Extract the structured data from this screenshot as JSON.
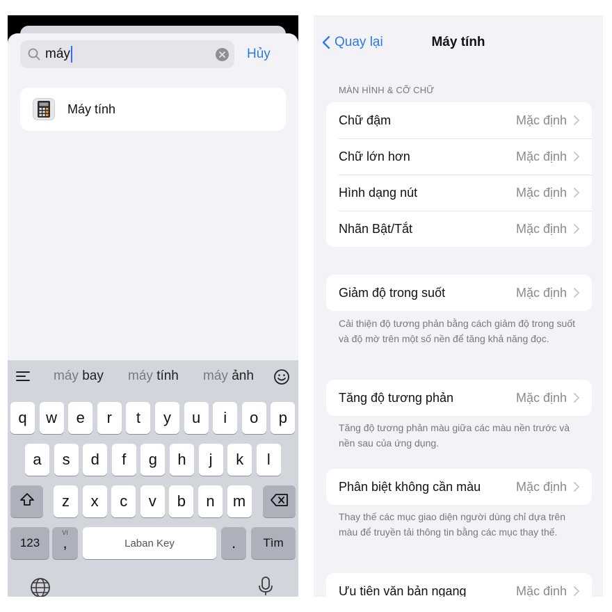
{
  "search": {
    "query": "máy",
    "cancel_label": "Hủy",
    "result_label": "Máy tính"
  },
  "keyboard": {
    "suggestions": [
      {
        "prefix": "máy ",
        "word": "bay"
      },
      {
        "prefix": "máy ",
        "word": "tính"
      },
      {
        "prefix": "máy ",
        "word": "ảnh"
      }
    ],
    "row1": [
      "q",
      "w",
      "e",
      "r",
      "t",
      "y",
      "u",
      "i",
      "o",
      "p"
    ],
    "row2": [
      "a",
      "s",
      "d",
      "f",
      "g",
      "h",
      "j",
      "k",
      "l"
    ],
    "row3": [
      "z",
      "x",
      "c",
      "v",
      "b",
      "n",
      "m"
    ],
    "numbers_label": "123",
    "lang_label": "VI",
    "comma_label": ",",
    "space_label": "Laban Key",
    "period_label": ".",
    "return_label": "Tìm"
  },
  "settings": {
    "back_label": "Quay lại",
    "title": "Máy tính",
    "section_header": "MÀN HÌNH & CỠ CHỮ",
    "default_value": "Mặc định",
    "group1": [
      "Chữ đậm",
      "Chữ lớn hơn",
      "Hình dạng nút",
      "Nhãn Bật/Tắt"
    ],
    "reduce_transparency": "Giảm độ trong suốt",
    "reduce_transparency_note": "Cải thiện độ tương phản bằng cách giảm độ trong suốt và độ mờ trên một số nền để tăng khả năng đọc.",
    "increase_contrast": "Tăng độ tương phản",
    "increase_contrast_note": "Tăng độ tương phản màu giữa các màu nền trước và nền sau của ứng dụng.",
    "differentiate": "Phân biệt không cần màu",
    "differentiate_note": "Thay thế các mục giao diện người dùng chỉ dựa trên màu để truyền tải thông tin bằng các mục thay thế.",
    "prefer_horizontal": "Ưu tiên văn bản ngang"
  },
  "colors": {
    "accent": "#2e78e8",
    "secondary_text": "#8a8a8f",
    "background": "#f2f2f7"
  }
}
